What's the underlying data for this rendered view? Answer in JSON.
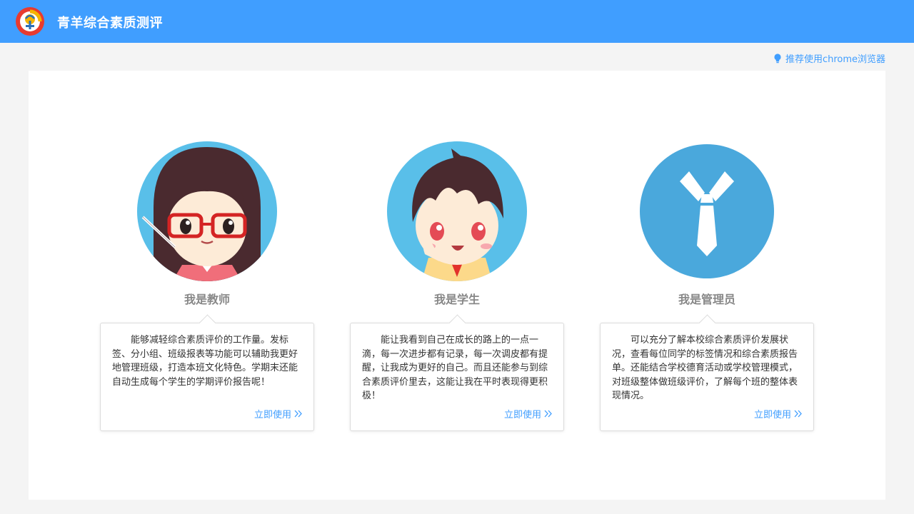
{
  "header": {
    "app_title": "青羊综合素质测评",
    "browser_tip": "推荐使用chrome浏览器"
  },
  "roles": [
    {
      "title": "我是教师",
      "description": "能够减轻综合素质评价的工作量。发标签、分小组、班级报表等功能可以辅助我更好地管理班级，打造本班文化特色。学期末还能自动生成每个学生的学期评价报告呢！",
      "link": "立即使用",
      "avatar_icon": "teacher-avatar-icon"
    },
    {
      "title": "我是学生",
      "description": "能让我看到自己在成长的路上的一点一滴，每一次进步都有记录，每一次调皮都有提醒，让我成为更好的自己。而且还能参与到综合素质评价里去，这能让我在平时表现得更积极！",
      "link": "立即使用",
      "avatar_icon": "student-avatar-icon"
    },
    {
      "title": "我是管理员",
      "description": "可以充分了解本校综合素质评价发展状况，查看每位同学的标签情况和综合素质报告单。还能结合学校德育活动或学校管理模式，对班级整体做班级评价，了解每个班的整体表现情况。",
      "link": "立即使用",
      "avatar_icon": "admin-tie-icon"
    }
  ],
  "colors": {
    "header_bg": "#409eff",
    "accent": "#409eff",
    "avatar_blue": "#4aa8dc",
    "page_bg": "#f4f4f4"
  }
}
